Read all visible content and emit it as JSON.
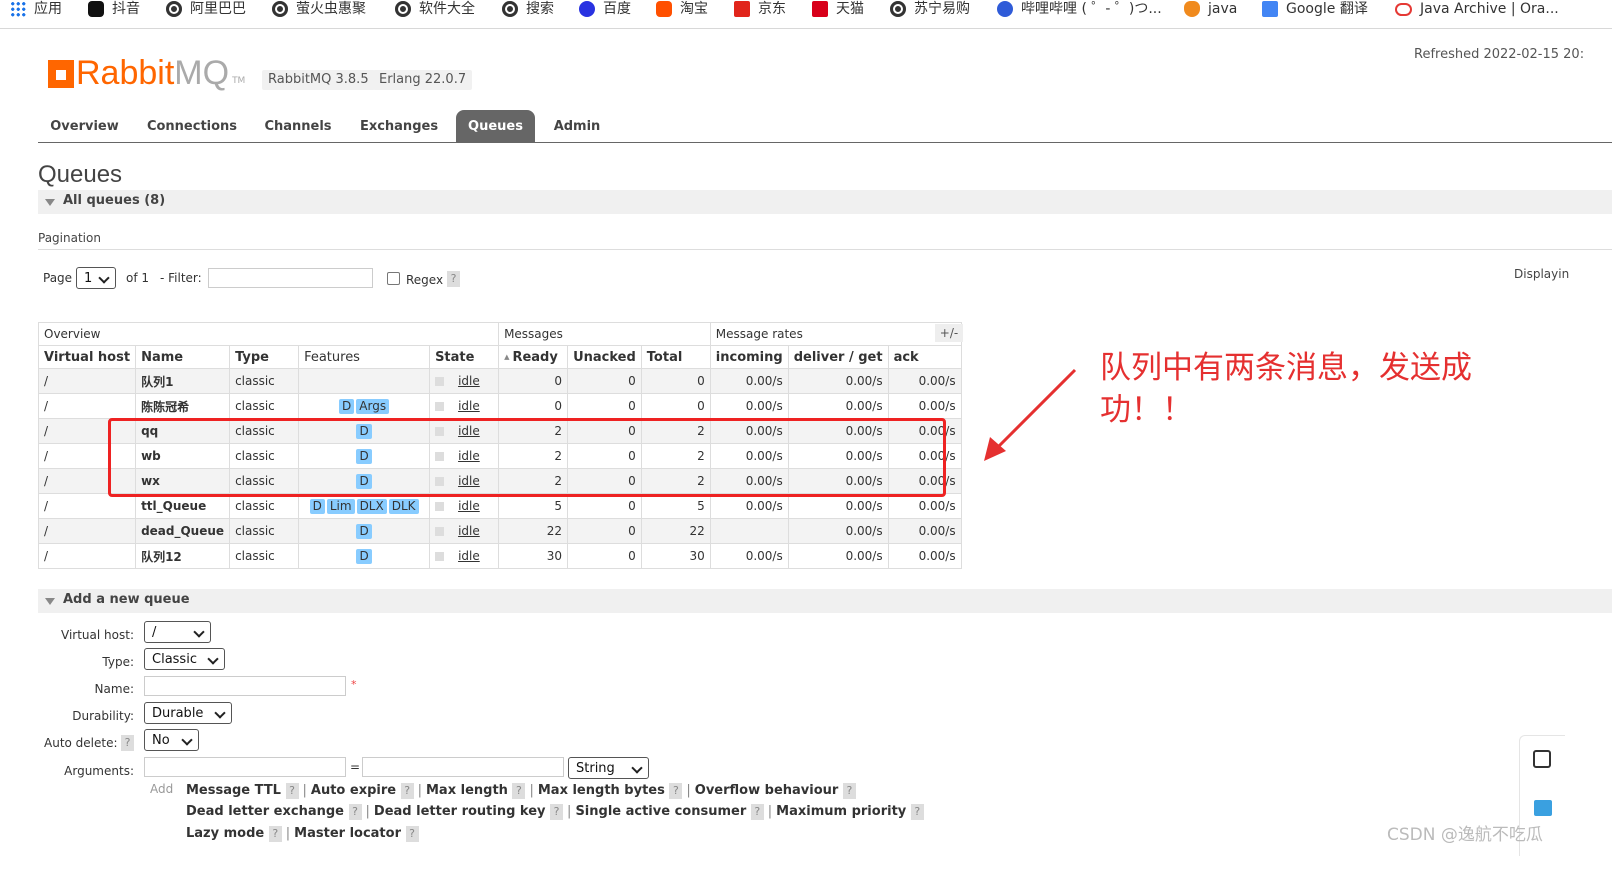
{
  "bookmarks": [
    {
      "label": "应用",
      "icon": "apps-grid-icon"
    },
    {
      "label": "抖音",
      "icon": "tiktok-icon"
    },
    {
      "label": "阿里巴巴",
      "icon": "globe-icon"
    },
    {
      "label": "萤火虫惠聚",
      "icon": "globe-icon"
    },
    {
      "label": "软件大全",
      "icon": "globe-icon"
    },
    {
      "label": "搜索",
      "icon": "globe-icon"
    },
    {
      "label": "百度",
      "icon": "baidu-icon"
    },
    {
      "label": "淘宝",
      "icon": "taobao-icon"
    },
    {
      "label": "京东",
      "icon": "jd-icon"
    },
    {
      "label": "天猫",
      "icon": "tmall-icon"
    },
    {
      "label": "苏宁易购",
      "icon": "globe-icon"
    },
    {
      "label": "哔哩哔哩 ( ゜- ゜)つ...",
      "icon": "bilibili-icon"
    },
    {
      "label": "java",
      "icon": "java-icon"
    },
    {
      "label": "Google 翻译",
      "icon": "google-translate-icon"
    },
    {
      "label": "Java Archive | Ora...",
      "icon": "oracle-icon"
    }
  ],
  "header": {
    "logo_rabbit": "Rabbit",
    "logo_mq": "MQ",
    "logo_tm": "TM",
    "version": "RabbitMQ 3.8.5",
    "erlang": "Erlang 22.0.7",
    "refreshed": "Refreshed 2022-02-15 20:"
  },
  "tabs": [
    {
      "label": "Overview",
      "active": false
    },
    {
      "label": "Connections",
      "active": false
    },
    {
      "label": "Channels",
      "active": false
    },
    {
      "label": "Exchanges",
      "active": false
    },
    {
      "label": "Queues",
      "active": true
    },
    {
      "label": "Admin",
      "active": false
    }
  ],
  "queues": {
    "title": "Queues",
    "all_queues": "All queues (8)",
    "pagination_label": "Pagination",
    "page_label": "Page",
    "page_value": "1",
    "of_label": "of 1",
    "filter_label": "- Filter:",
    "filter_value": "",
    "regex_label": "Regex",
    "help_mark": "?",
    "displaying": "Displayin",
    "plus_minus": "+/-",
    "group_headers": [
      "Overview",
      "Messages",
      "Message rates"
    ],
    "columns": [
      "Virtual host",
      "Name",
      "Type",
      "Features",
      "State",
      "Ready",
      "Unacked",
      "Total",
      "incoming",
      "deliver / get",
      "ack"
    ],
    "rows": [
      {
        "vhost": "/",
        "name": "队列1",
        "type": "classic",
        "features": [],
        "state": "idle",
        "ready": "0",
        "unacked": "0",
        "total": "0",
        "incoming": "0.00/s",
        "deliver": "0.00/s",
        "ack": "0.00/s"
      },
      {
        "vhost": "/",
        "name": "陈陈冠希",
        "type": "classic",
        "features": [
          "D",
          "Args"
        ],
        "state": "idle",
        "ready": "0",
        "unacked": "0",
        "total": "0",
        "incoming": "0.00/s",
        "deliver": "0.00/s",
        "ack": "0.00/s"
      },
      {
        "vhost": "/",
        "name": "qq",
        "type": "classic",
        "features": [
          "D"
        ],
        "state": "idle",
        "ready": "2",
        "unacked": "0",
        "total": "2",
        "incoming": "0.00/s",
        "deliver": "0.00/s",
        "ack": "0.00/s"
      },
      {
        "vhost": "/",
        "name": "wb",
        "type": "classic",
        "features": [
          "D"
        ],
        "state": "idle",
        "ready": "2",
        "unacked": "0",
        "total": "2",
        "incoming": "0.00/s",
        "deliver": "0.00/s",
        "ack": "0.00/s"
      },
      {
        "vhost": "/",
        "name": "wx",
        "type": "classic",
        "features": [
          "D"
        ],
        "state": "idle",
        "ready": "2",
        "unacked": "0",
        "total": "2",
        "incoming": "0.00/s",
        "deliver": "0.00/s",
        "ack": "0.00/s"
      },
      {
        "vhost": "/",
        "name": "ttl_Queue",
        "type": "classic",
        "features": [
          "D",
          "Lim",
          "DLX",
          "DLK"
        ],
        "state": "idle",
        "ready": "5",
        "unacked": "0",
        "total": "5",
        "incoming": "0.00/s",
        "deliver": "0.00/s",
        "ack": "0.00/s"
      },
      {
        "vhost": "/",
        "name": "dead_Queue",
        "type": "classic",
        "features": [
          "D"
        ],
        "state": "idle",
        "ready": "22",
        "unacked": "0",
        "total": "22",
        "incoming": "",
        "deliver": "0.00/s",
        "ack": "0.00/s"
      },
      {
        "vhost": "/",
        "name": "队列12",
        "type": "classic",
        "features": [
          "D"
        ],
        "state": "idle",
        "ready": "30",
        "unacked": "0",
        "total": "30",
        "incoming": "0.00/s",
        "deliver": "0.00/s",
        "ack": "0.00/s"
      }
    ]
  },
  "annotation": {
    "text": "队列中有两条消息，发送成功！！",
    "color": "#e53030"
  },
  "add_queue": {
    "title": "Add a new queue",
    "vhost_label": "Virtual host:",
    "vhost_value": "/",
    "type_label": "Type:",
    "type_value": "Classic",
    "name_label": "Name:",
    "name_value": "",
    "required_mark": "*",
    "durability_label": "Durability:",
    "durability_value": "Durable",
    "autodelete_label": "Auto delete:",
    "autodelete_value": "No",
    "arguments_label": "Arguments:",
    "arg_equals": "=",
    "arg_type_value": "String",
    "add_word": "Add",
    "arg_links_row1": [
      "Message TTL",
      "Auto expire",
      "Max length",
      "Max length bytes",
      "Overflow behaviour"
    ],
    "arg_links_row2": [
      "Dead letter exchange",
      "Dead letter routing key",
      "Single active consumer",
      "Maximum priority"
    ],
    "arg_links_row3": [
      "Lazy mode",
      "Master locator"
    ]
  },
  "watermark": "CSDN @逸航不吃瓜"
}
